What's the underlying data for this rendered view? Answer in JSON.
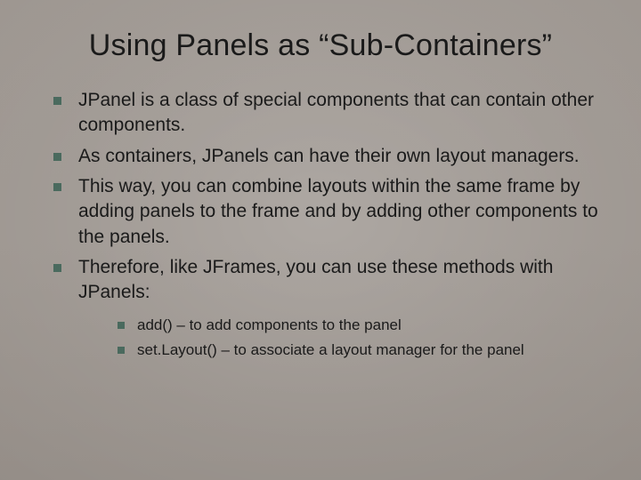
{
  "title": "Using Panels as “Sub-Containers”",
  "bullets": [
    "JPanel is a class of special components that can contain other components.",
    "As containers, JPanels can have their own layout managers.",
    "This way, you can combine layouts within the same frame by adding panels to the frame and by adding other components to the panels.",
    "Therefore, like JFrames,  you can use these methods with JPanels:"
  ],
  "subbullets": [
    "add() – to add components to the panel",
    "set.Layout() – to associate a layout manager for the panel"
  ]
}
